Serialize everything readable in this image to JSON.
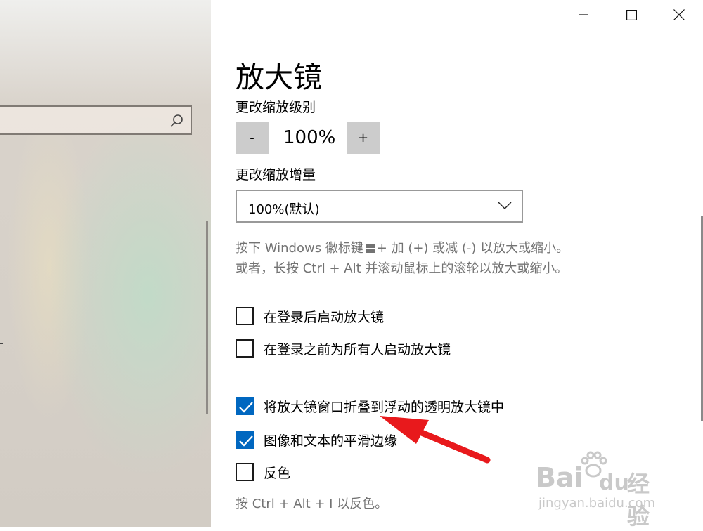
{
  "window": {
    "minimize_icon": "minimize-icon",
    "maximize_icon": "maximize-icon",
    "close_icon": "close-icon"
  },
  "sidebar": {
    "search_icon": "search-icon"
  },
  "page": {
    "title": "放大镜"
  },
  "zoom_level": {
    "label": "更改缩放级别",
    "decrease_label": "-",
    "value": "100%",
    "increase_label": "+"
  },
  "zoom_increment": {
    "label": "更改缩放增量",
    "selected": "100%(默认)"
  },
  "help": {
    "line1_before": "按下 Windows 徽标键",
    "line1_after": "+ 加 (+) 或减 (-) 以放大或缩小。",
    "line2": "或者，长按 Ctrl + Alt 并滚动鼠标上的滚轮以放大或缩小。",
    "invert_hint": "按 Ctrl + Alt + I 以反色。"
  },
  "options": [
    {
      "label": "在登录后启动放大镜",
      "checked": false
    },
    {
      "label": "在登录之前为所有人启动放大镜",
      "checked": false
    },
    {
      "label": "将放大镜窗口折叠到浮动的透明放大镜中",
      "checked": true
    },
    {
      "label": "图像和文本的平滑边缘",
      "checked": true
    },
    {
      "label": "反色",
      "checked": false
    }
  ],
  "colors": {
    "accent": "#0067c0",
    "annotation_arrow": "#e8191c"
  },
  "watermark": {
    "brand": "Bai",
    "brand_tail": "du",
    "cn": "经验",
    "url": "jingyan.baidu.com"
  }
}
